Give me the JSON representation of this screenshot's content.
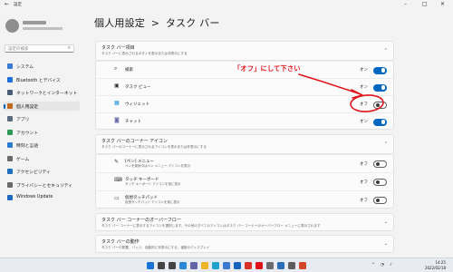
{
  "window": {
    "app_name": "設定",
    "back_icon": "back-arrow-icon",
    "controls": [
      "minimize-icon",
      "maximize-icon",
      "close-icon"
    ]
  },
  "sidebar": {
    "search_placeholder": "設定の検索",
    "search_icon": "search-icon",
    "items": [
      {
        "label": "システム",
        "icon": "monitor-icon",
        "color": "#3a7bd5",
        "selected": false
      },
      {
        "label": "Bluetooth とデバイス",
        "icon": "bluetooth-icon",
        "color": "#1e6fd9",
        "selected": false
      },
      {
        "label": "ネットワークとインターネット",
        "icon": "network-icon",
        "color": "#4a5d78",
        "selected": false
      },
      {
        "label": "個人用設定",
        "icon": "brush-icon",
        "color": "#c46a1f",
        "selected": true
      },
      {
        "label": "アプリ",
        "icon": "apps-icon",
        "color": "#5b6b7e",
        "selected": false
      },
      {
        "label": "アカウント",
        "icon": "account-icon",
        "color": "#2e9a58",
        "selected": false
      },
      {
        "label": "時刻と言語",
        "icon": "clock-globe-icon",
        "color": "#2f7bd0",
        "selected": false
      },
      {
        "label": "ゲーム",
        "icon": "gamepad-icon",
        "color": "#6b6b6b",
        "selected": false
      },
      {
        "label": "アクセシビリティ",
        "icon": "accessibility-icon",
        "color": "#1d6fc0",
        "selected": false
      },
      {
        "label": "プライバシーとセキュリティ",
        "icon": "shield-icon",
        "color": "#6a6a6a",
        "selected": false
      },
      {
        "label": "Windows Update",
        "icon": "update-icon",
        "color": "#1c6ac4",
        "selected": false
      }
    ]
  },
  "page": {
    "breadcrumb_parent": "個人用設定",
    "breadcrumb_sep": ">",
    "title": "タスク バー"
  },
  "section_items": {
    "title": "タスク バー項目",
    "desc": "タスク バーに表示されるボタンを表示または非表示にする",
    "rows": [
      {
        "label": "検索",
        "icon": "search-icon",
        "state_label": "オン",
        "on": true
      },
      {
        "label": "タスク ビュー",
        "icon": "task-view-icon",
        "state_label": "オン",
        "on": true
      },
      {
        "label": "ウィジェット",
        "icon": "widgets-icon",
        "state_label": "オフ",
        "on": false
      },
      {
        "label": "チャット",
        "icon": "chat-icon",
        "state_label": "オン",
        "on": true
      }
    ]
  },
  "section_corner_icons": {
    "title": "タスク バーのコーナー アイコン",
    "desc": "タスク バーのコーナーに表示されるアイコンを表示または非表示にする",
    "rows": [
      {
        "label": "[ペン] メニュー",
        "desc": "ペンを使用中はペン メニュー アイコンを表示",
        "icon": "pen-icon",
        "state_label": "オフ",
        "on": false
      },
      {
        "label": "タッチ キーボード",
        "desc": "タッチ キーボード アイコンを常に表示",
        "icon": "keyboard-icon",
        "state_label": "オフ",
        "on": false
      },
      {
        "label": "仮想タッチパッド",
        "desc": "仮想タッチパッド アイコンを常に表示",
        "icon": "touchpad-icon",
        "state_label": "オフ",
        "on": false
      }
    ]
  },
  "section_overflow": {
    "title": "タスク バー コーナーのオーバーフロー",
    "desc": "タスク バー コーナーに表示するアイコンを選択します。その他のすべてのアイコンはタスク バー コーナーのオーバーフロー メニューに表示されます"
  },
  "section_behavior": {
    "title": "タスク バーの動作",
    "desc": "タスク バーの配置、バッジ、自動的に非表示にする、複数のディスプレイ"
  },
  "annotation": {
    "text": "「オフ」にして下さい",
    "color": "#e0141b"
  },
  "taskbar": {
    "apps": [
      {
        "name": "start-icon",
        "color": "#1a73d9"
      },
      {
        "name": "search-icon",
        "color": "#444"
      },
      {
        "name": "task-view-icon",
        "color": "#444"
      },
      {
        "name": "widgets-icon",
        "color": "#2b88d8"
      },
      {
        "name": "chat-icon",
        "color": "#6264a7"
      },
      {
        "name": "file-explorer-icon",
        "color": "#f0b429"
      },
      {
        "name": "edge-icon",
        "color": "#1fa2c9"
      },
      {
        "name": "store-icon",
        "color": "#3b78d1"
      },
      {
        "name": "mail-icon",
        "color": "#1565c0"
      },
      {
        "name": "chrome-icon",
        "color": "#d93025"
      },
      {
        "name": "yahoo-icon",
        "color": "#e0101b"
      },
      {
        "name": "settings-icon",
        "color": "#6b6b6b"
      },
      {
        "name": "photos-icon",
        "color": "#2c6cb8"
      },
      {
        "name": "calculator-icon",
        "color": "#5d5d5d"
      },
      {
        "name": "media-icon",
        "color": "#d24726"
      }
    ],
    "tray_chevron": "^",
    "time": "14:25",
    "date": "2022/02/18"
  }
}
